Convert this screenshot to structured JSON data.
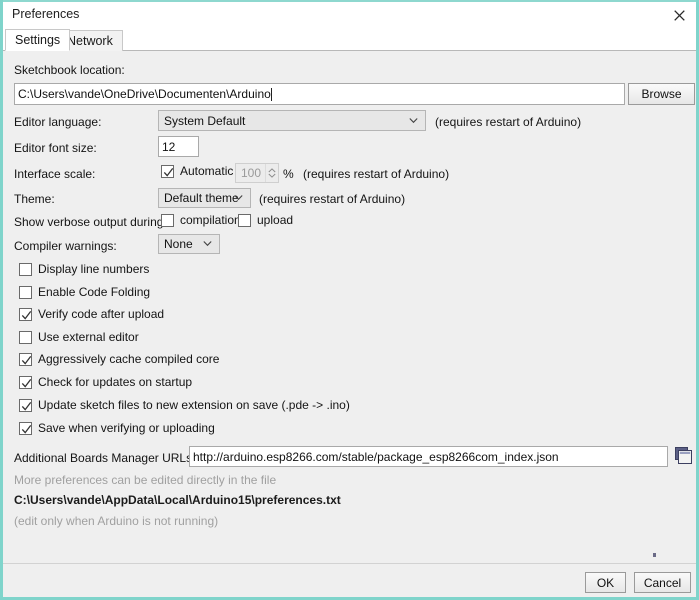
{
  "window": {
    "title": "Preferences",
    "close_icon": "close-icon"
  },
  "tabs": [
    {
      "label": "Settings",
      "active": true
    },
    {
      "label": "Network",
      "active": false
    }
  ],
  "settings": {
    "sketchbook": {
      "label": "Sketchbook location:",
      "value": "C:\\Users\\vande\\OneDrive\\Documenten\\Arduino",
      "browse_label": "Browse"
    },
    "editor_language": {
      "label": "Editor language:",
      "value": "System Default",
      "note": "(requires restart of Arduino)"
    },
    "editor_font_size": {
      "label": "Editor font size:",
      "value": "12"
    },
    "interface_scale": {
      "label": "Interface scale:",
      "automatic_label": "Automatic",
      "automatic_checked": true,
      "scale_value": "100",
      "percent_label": "%",
      "note": "(requires restart of Arduino)"
    },
    "theme": {
      "label": "Theme:",
      "value": "Default theme",
      "note": "(requires restart of Arduino)"
    },
    "verbose": {
      "label": "Show verbose output during:",
      "compilation_label": "compilation",
      "compilation_checked": false,
      "upload_label": "upload",
      "upload_checked": false
    },
    "compiler_warnings": {
      "label": "Compiler warnings:",
      "value": "None"
    },
    "checkboxes": [
      {
        "label": "Display line numbers",
        "checked": false
      },
      {
        "label": "Enable Code Folding",
        "checked": false
      },
      {
        "label": "Verify code after upload",
        "checked": true
      },
      {
        "label": "Use external editor",
        "checked": false
      },
      {
        "label": "Aggressively cache compiled core",
        "checked": true
      },
      {
        "label": "Check for updates on startup",
        "checked": true
      },
      {
        "label": "Update sketch files to new extension on save (.pde -> .ino)",
        "checked": true
      },
      {
        "label": "Save when verifying or uploading",
        "checked": true
      }
    ],
    "boards_urls": {
      "label": "Additional Boards Manager URLs:",
      "value": "http://arduino.esp8266.com/stable/package_esp8266com_index.json",
      "expand_icon": "open-editor-icon"
    },
    "footer_info": {
      "line1": "More preferences can be edited directly in the file",
      "line2": "C:\\Users\\vande\\AppData\\Local\\Arduino15\\preferences.txt",
      "line3": "(edit only when Arduino is not running)"
    }
  },
  "footer_buttons": {
    "ok_label": "OK",
    "cancel_label": "Cancel"
  },
  "colors": {
    "window_border": "#7fd4cb",
    "panel_bg": "#efefef",
    "titlebar_bg": "#ffffff"
  }
}
